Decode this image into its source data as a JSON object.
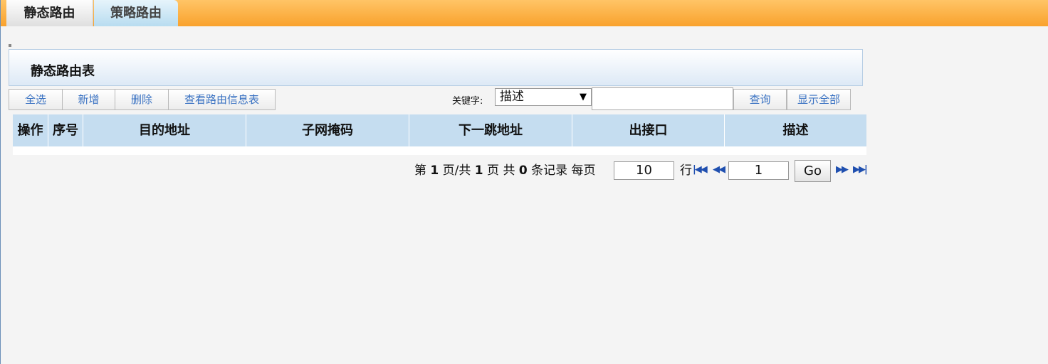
{
  "tabs": [
    {
      "label": "静态路由",
      "active": true
    },
    {
      "label": "策略路由",
      "active": false
    }
  ],
  "panel": {
    "title": "静态路由表"
  },
  "toolbar": {
    "select_all": "全选",
    "add": "新增",
    "delete": "删除",
    "view_route_info": "查看路由信息表",
    "keyword_label": "关键字:",
    "keyword_field": "描述",
    "keyword_value": "",
    "search": "查询",
    "show_all": "显示全部"
  },
  "table": {
    "columns": [
      "操作",
      "序号",
      "目的地址",
      "子网掩码",
      "下一跳地址",
      "出接口",
      "描述"
    ],
    "rows": []
  },
  "pagination": {
    "prefix": "第",
    "current_page": "1",
    "page_sep": "页/共",
    "total_pages": "1",
    "page_suffix": "页 共",
    "total_records": "0",
    "records_suffix": "条记录 每页",
    "per_page": "10",
    "per_page_unit": "行",
    "goto_page": "1",
    "go_label": "Go"
  },
  "colors": {
    "tab_bar": "#f9a22d",
    "header_bg": "#c5ddf0",
    "link_blue": "#3a72c2"
  },
  "icons": [
    "first-page-icon",
    "prev-page-icon",
    "next-page-icon",
    "last-page-icon"
  ]
}
